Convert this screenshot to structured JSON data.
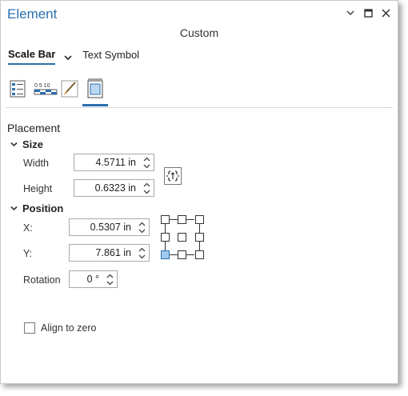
{
  "window": {
    "title": "Element"
  },
  "subtitle": "Custom",
  "elements": {
    "active": "Scale Bar",
    "other": "Text Symbol"
  },
  "tabs": [
    {
      "name": "options-icon"
    },
    {
      "name": "scale-bar-icon",
      "text": "0 5 10"
    },
    {
      "name": "symbol-brush-icon"
    },
    {
      "name": "display-icon",
      "active": true
    }
  ],
  "placement": {
    "heading": "Placement",
    "size": {
      "label": "Size",
      "width_label": "Width",
      "width_value": "4.5711 in",
      "height_label": "Height",
      "height_value": "0.6323 in"
    },
    "position": {
      "label": "Position",
      "x_label": "X:",
      "x_value": "0.5307 in",
      "y_label": "Y:",
      "y_value": "7.861 in",
      "rotation_label": "Rotation",
      "rotation_value": "0 °",
      "anchor_selected": "bottom-left"
    }
  },
  "align_to_zero": {
    "label": "Align to zero",
    "checked": false
  },
  "colors": {
    "accent": "#2a6fb0",
    "anchor_selected": "#9fc8ee"
  }
}
